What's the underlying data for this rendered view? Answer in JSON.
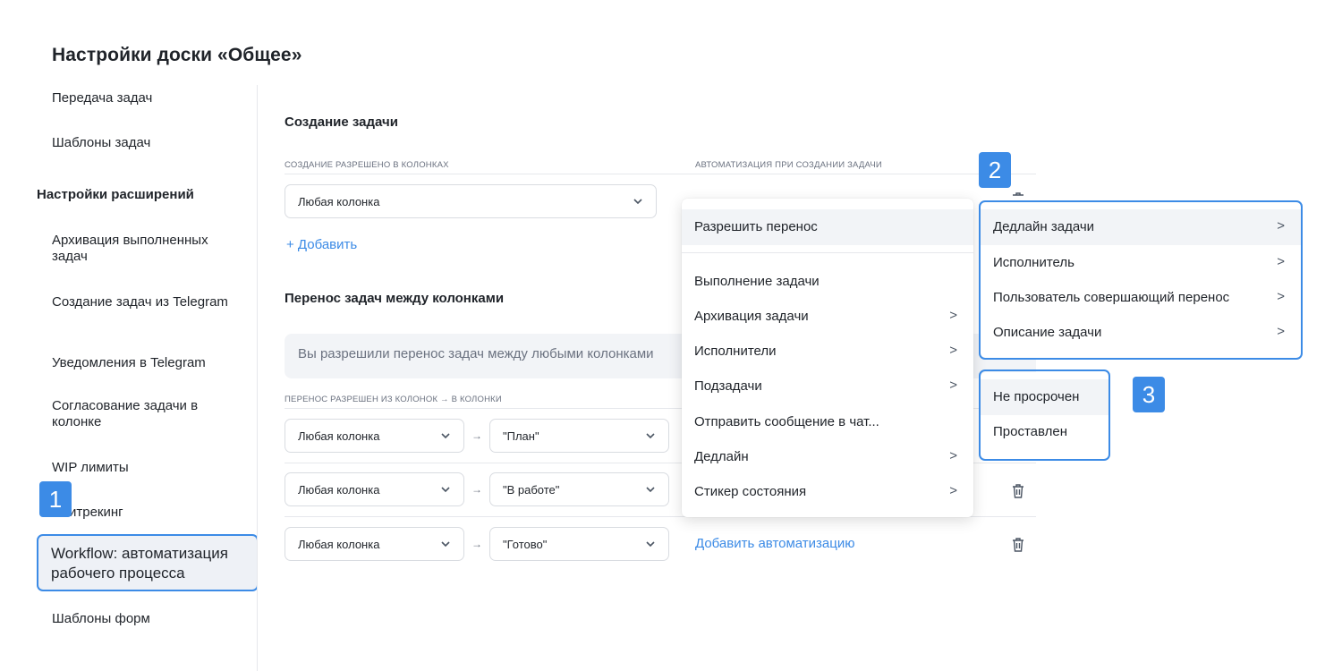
{
  "page": {
    "title": "Настройки доски «Общее»"
  },
  "sidebar": {
    "items": [
      {
        "label": "Передача задач"
      },
      {
        "label": "Шаблоны задач"
      },
      {
        "label": "Архивация выполненных задач"
      },
      {
        "label": "Создание задач из Telegram"
      },
      {
        "label": "Уведомления в Telegram"
      },
      {
        "label": "Согласование задачи в колонке"
      },
      {
        "label": "WIP лимиты"
      },
      {
        "label": "итрекинг"
      },
      {
        "label": "Workflow: автоматизация рабочего процесса"
      },
      {
        "label": "Шаблоны форм"
      }
    ],
    "section_heading": "Настройки расширений"
  },
  "create": {
    "title": "Создание задачи",
    "columns_caption": "Создание разрешено в колонках",
    "automation_caption": "Автоматизация при создании задачи",
    "select_value": "Любая колонка",
    "add_label": "+ Добавить"
  },
  "transfer": {
    "title": "Перенос задач между колонками",
    "info": "Вы разрешили перенос задач между любыми колонками",
    "caption": "Перенос разрешен из колонок → в колонки",
    "arrow": "→",
    "rows": [
      {
        "from": "Любая колонка",
        "to": "\"План\""
      },
      {
        "from": "Любая колонка",
        "to": "\"В работе\""
      },
      {
        "from": "Любая колонка",
        "to": "\"Готово\"",
        "action": "Добавить автоматизацию"
      }
    ]
  },
  "menu_main": {
    "items": [
      {
        "label": "Разрешить перенос",
        "submenu": ""
      },
      {
        "label": "Выполнение задачи",
        "submenu": ""
      },
      {
        "label": "Архивация задачи",
        "submenu": ">"
      },
      {
        "label": "Исполнители",
        "submenu": ">"
      },
      {
        "label": "Подзадачи",
        "submenu": ">"
      },
      {
        "label": "Отправить сообщение в чат...",
        "submenu": ""
      },
      {
        "label": "Дедлайн",
        "submenu": ">"
      },
      {
        "label": "Стикер состояния",
        "submenu": ">"
      }
    ]
  },
  "menu_sub": {
    "items": [
      {
        "label": "Дедлайн задачи",
        "submenu": ">"
      },
      {
        "label": "Исполнитель",
        "submenu": ">"
      },
      {
        "label": "Пользователь совершающий перенос",
        "submenu": ">"
      },
      {
        "label": "Описание задачи",
        "submenu": ">"
      }
    ]
  },
  "menu_values": {
    "items": [
      {
        "label": "Не просрочен"
      },
      {
        "label": "Проставлен"
      }
    ]
  },
  "badges": [
    "1",
    "2",
    "3"
  ],
  "colors": {
    "accent": "#3c8be6",
    "text": "#1f2329",
    "muted": "#6b7280"
  }
}
